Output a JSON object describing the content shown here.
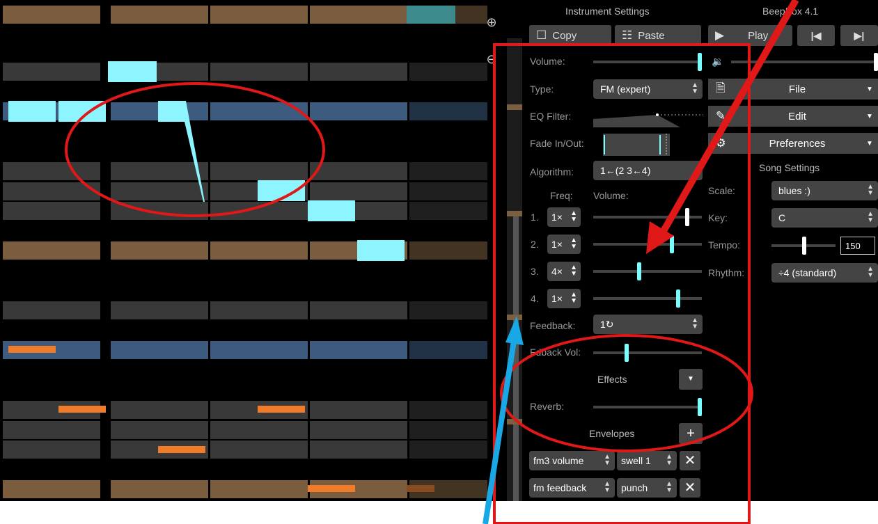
{
  "header": {
    "instrument_settings": "Instrument Settings",
    "app_version": "BeepBox 4.1"
  },
  "toolbar": {
    "copy": "Copy",
    "paste": "Paste",
    "play": "Play",
    "prev_icon": "skip-back-icon",
    "next_icon": "skip-forward-icon"
  },
  "instrument": {
    "volume_label": "Volume:",
    "volume_level": 1.0,
    "type_label": "Type:",
    "type_value": "FM (expert)",
    "eq_label": "EQ Filter:",
    "fade_label": "Fade In/Out:",
    "algorithm_label": "Algorithm:",
    "algorithm_value": "1←(2 3←4)",
    "freq_header": "Freq:",
    "op_volume_header": "Volume:",
    "operators": [
      {
        "index": "1.",
        "freq": "1×",
        "volume": 0.88
      },
      {
        "index": "2.",
        "freq": "1×",
        "volume": 0.73
      },
      {
        "index": "3.",
        "freq": "4×",
        "volume": 0.42
      },
      {
        "index": "4.",
        "freq": "1×",
        "volume": 0.79
      }
    ],
    "feedback_label": "Feedback:",
    "feedback_value": "1↻",
    "fdback_vol_label": "Fdback Vol:",
    "fdback_vol_level": 0.3,
    "effects_label": "Effects",
    "reverb_label": "Reverb:",
    "reverb_level": 1.0,
    "envelopes_label": "Envelopes",
    "envelopes": [
      {
        "target": "fm3 volume",
        "shape": "swell 1"
      },
      {
        "target": "fm feedback",
        "shape": "punch"
      }
    ]
  },
  "menus": {
    "file": "File",
    "edit": "Edit",
    "preferences": "Preferences"
  },
  "song": {
    "settings_label": "Song Settings",
    "scale_label": "Scale:",
    "scale_value": "blues :)",
    "key_label": "Key:",
    "key_value": "C",
    "tempo_label": "Tempo:",
    "tempo_value": "150",
    "rhythm_label": "Rhythm:",
    "rhythm_value": "÷4 (standard)"
  },
  "colors": {
    "row_gray": "#393939",
    "row_brown": "#7a5c3e",
    "row_blue": "#3d5a7f",
    "note_cyan": "#8cf5ff",
    "note_orange": "#f07c2a",
    "accent_cyan": "#77ffff",
    "annotation_red": "#e01818",
    "annotation_blue": "#19a8e6"
  }
}
